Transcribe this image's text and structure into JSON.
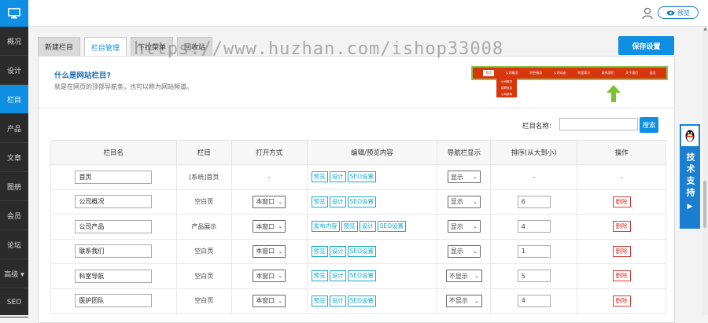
{
  "sidebar": {
    "items": [
      {
        "label": "概况"
      },
      {
        "label": "设计"
      },
      {
        "label": "栏目",
        "active": true
      },
      {
        "label": "产品"
      },
      {
        "label": "文章"
      },
      {
        "label": "图册"
      },
      {
        "label": "会员"
      },
      {
        "label": "论坛"
      },
      {
        "label": "高级 ▾"
      },
      {
        "label": "SEO"
      }
    ]
  },
  "header": {
    "preview_label": "预览"
  },
  "tabs": [
    {
      "label": "新建栏目"
    },
    {
      "label": "栏目管理",
      "active": true
    },
    {
      "label": "下拉菜单"
    },
    {
      "label": "回收站"
    }
  ],
  "save_label": "保存设置",
  "info": {
    "title": "什么是网站栏目?",
    "desc": "就是在网页的顶部导航条，也可以称为网站频道。"
  },
  "nav_demo": {
    "items": [
      "首页",
      "公司概况",
      "特色服务",
      "公司动态",
      "科室简介",
      "联系我们",
      "关于我们",
      "留言"
    ],
    "dropdown": [
      "公司概况",
      "招聘信息",
      "公司新闻"
    ]
  },
  "watermark": "https://www.huzhan.com/ishop33008",
  "search": {
    "label": "栏目名称:",
    "button": "搜索"
  },
  "table": {
    "headers": [
      "栏目名",
      "栏目",
      "打开方式",
      "编辑/预览内容",
      "导航栏显示",
      "排序(从大到小)",
      "操作"
    ],
    "rows": [
      {
        "name": "首页",
        "type": "[系统]首页",
        "open": "-",
        "actions": [
          "预览",
          "设计",
          "SEO设置"
        ],
        "show": "显示",
        "sort": "-",
        "op": "-"
      },
      {
        "name": "公司概况",
        "type": "空白页",
        "open": "本窗口",
        "actions": [
          "预览",
          "设计",
          "SEO设置"
        ],
        "show": "显示",
        "sort": "6",
        "op": "删除"
      },
      {
        "name": "公司产品",
        "type": "产品展示",
        "open": "本窗口",
        "actions": [
          "发布内容",
          "预览",
          "设计",
          "SEO设置"
        ],
        "show": "显示",
        "sort": "4",
        "op": "删除"
      },
      {
        "name": "联系我们",
        "type": "空白页",
        "open": "本窗口",
        "actions": [
          "预览",
          "设计",
          "SEO设置"
        ],
        "show": "显示",
        "sort": "1",
        "op": "删除"
      },
      {
        "name": "科室导航",
        "type": "空白页",
        "open": "本窗口",
        "actions": [
          "预览",
          "设计",
          "SEO设置"
        ],
        "show": "不显示",
        "sort": "5",
        "op": "删除"
      },
      {
        "name": "医护团队",
        "type": "空白页",
        "open": "本窗口",
        "actions": [
          "预览",
          "设计",
          "SEO设置"
        ],
        "show": "不显示",
        "sort": "4",
        "op": "删除"
      }
    ]
  },
  "support": {
    "label": "技术支持"
  },
  "colors": {
    "primary": "#0e8fe2",
    "sidebar_bg": "#2b2b2b",
    "action_border": "#1ba8c8",
    "delete": "#d43a3a",
    "nav_demo_bg": "#d8360d"
  }
}
